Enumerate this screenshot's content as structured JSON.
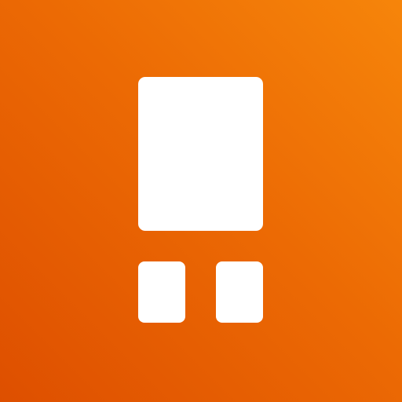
{
  "icon": {
    "name": "app-logo-icon",
    "background_gradient": [
      "#f6850a",
      "#ec6a04",
      "#de4f00"
    ],
    "shape_color": "#ffffff"
  }
}
